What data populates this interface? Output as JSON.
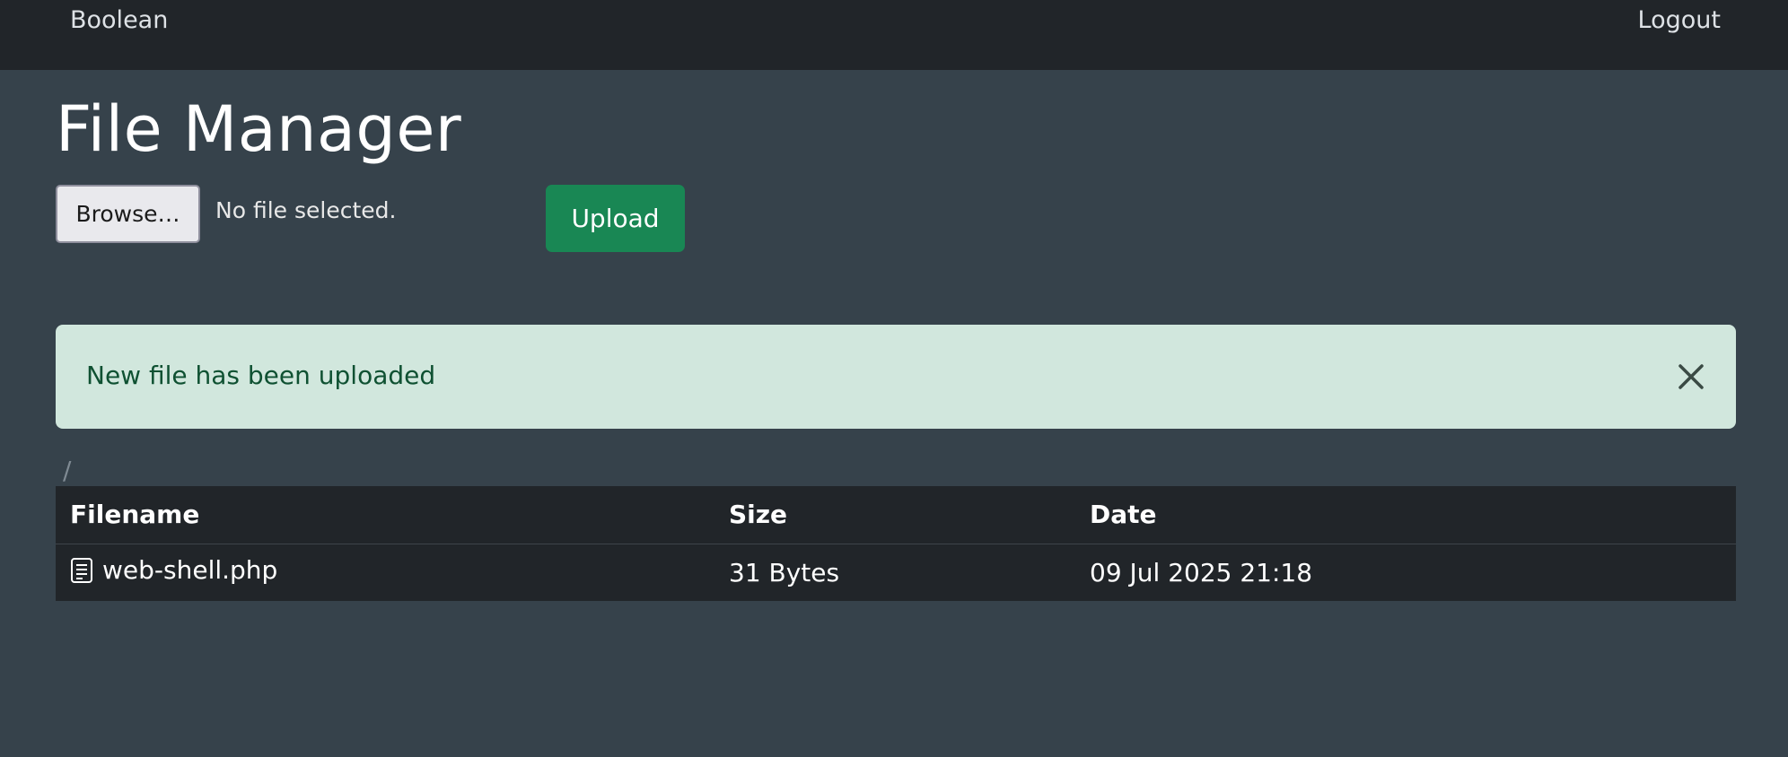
{
  "navbar": {
    "brand": "Boolean",
    "logout_label": "Logout"
  },
  "page": {
    "title": "File Manager"
  },
  "upload_form": {
    "browse_label": "Browse…",
    "file_status": "No file selected.",
    "upload_label": "Upload"
  },
  "alert": {
    "message": "New file has been uploaded",
    "close_icon": "close-icon",
    "colors": {
      "background": "#d1e7dd",
      "text": "#0f5132"
    }
  },
  "breadcrumb": {
    "path": "/"
  },
  "table": {
    "headers": [
      "Filename",
      "Size",
      "Date"
    ],
    "rows": [
      {
        "icon": "file-text-icon",
        "filename": "web-shell.php",
        "size": "31 Bytes",
        "date": "09 Jul 2025 21:18"
      }
    ]
  },
  "colors": {
    "navbar": "#212529",
    "page_background": "#36424b",
    "upload_button": "#198754"
  }
}
